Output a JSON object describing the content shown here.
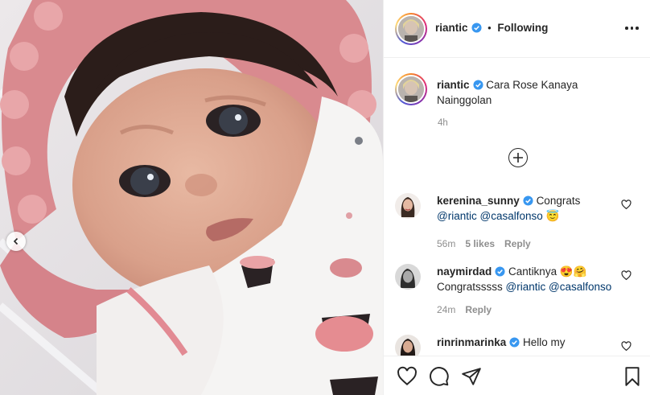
{
  "post": {
    "username": "riantic",
    "separator": "•",
    "follow_status": "Following"
  },
  "caption": {
    "username": "riantic",
    "text": "Cara Rose Kanaya Nainggolan",
    "time": "4h"
  },
  "comments": [
    {
      "username": "kerenina_sunny",
      "text": "Congrats",
      "mentions": [
        "@riantic",
        "@casalfonso"
      ],
      "emoji": "😇",
      "time": "56m",
      "likes": "5 likes",
      "reply": "Reply"
    },
    {
      "username": "naymirdad",
      "text": "Cantiknya",
      "emoji": "😍🤗",
      "text2": "Congratsssss",
      "mentions": [
        "@riantic",
        "@casalfonso"
      ],
      "time": "24m",
      "reply": "Reply"
    },
    {
      "username": "rinrinmarinka",
      "text": "Hello my"
    }
  ],
  "icons": {
    "prev": "chevron-left-icon",
    "more": "more-options-icon",
    "verified": "verified-badge-icon",
    "load_more": "plus-circle-icon",
    "like_comment": "heart-icon",
    "like": "heart-icon",
    "comment": "comment-icon",
    "share": "share-icon",
    "save": "bookmark-icon"
  },
  "colors": {
    "verified": "#3897f0",
    "text": "#262626",
    "secondary": "#8e8e8e",
    "mention": "#00376b",
    "hood_pink": "#d98a8f"
  }
}
